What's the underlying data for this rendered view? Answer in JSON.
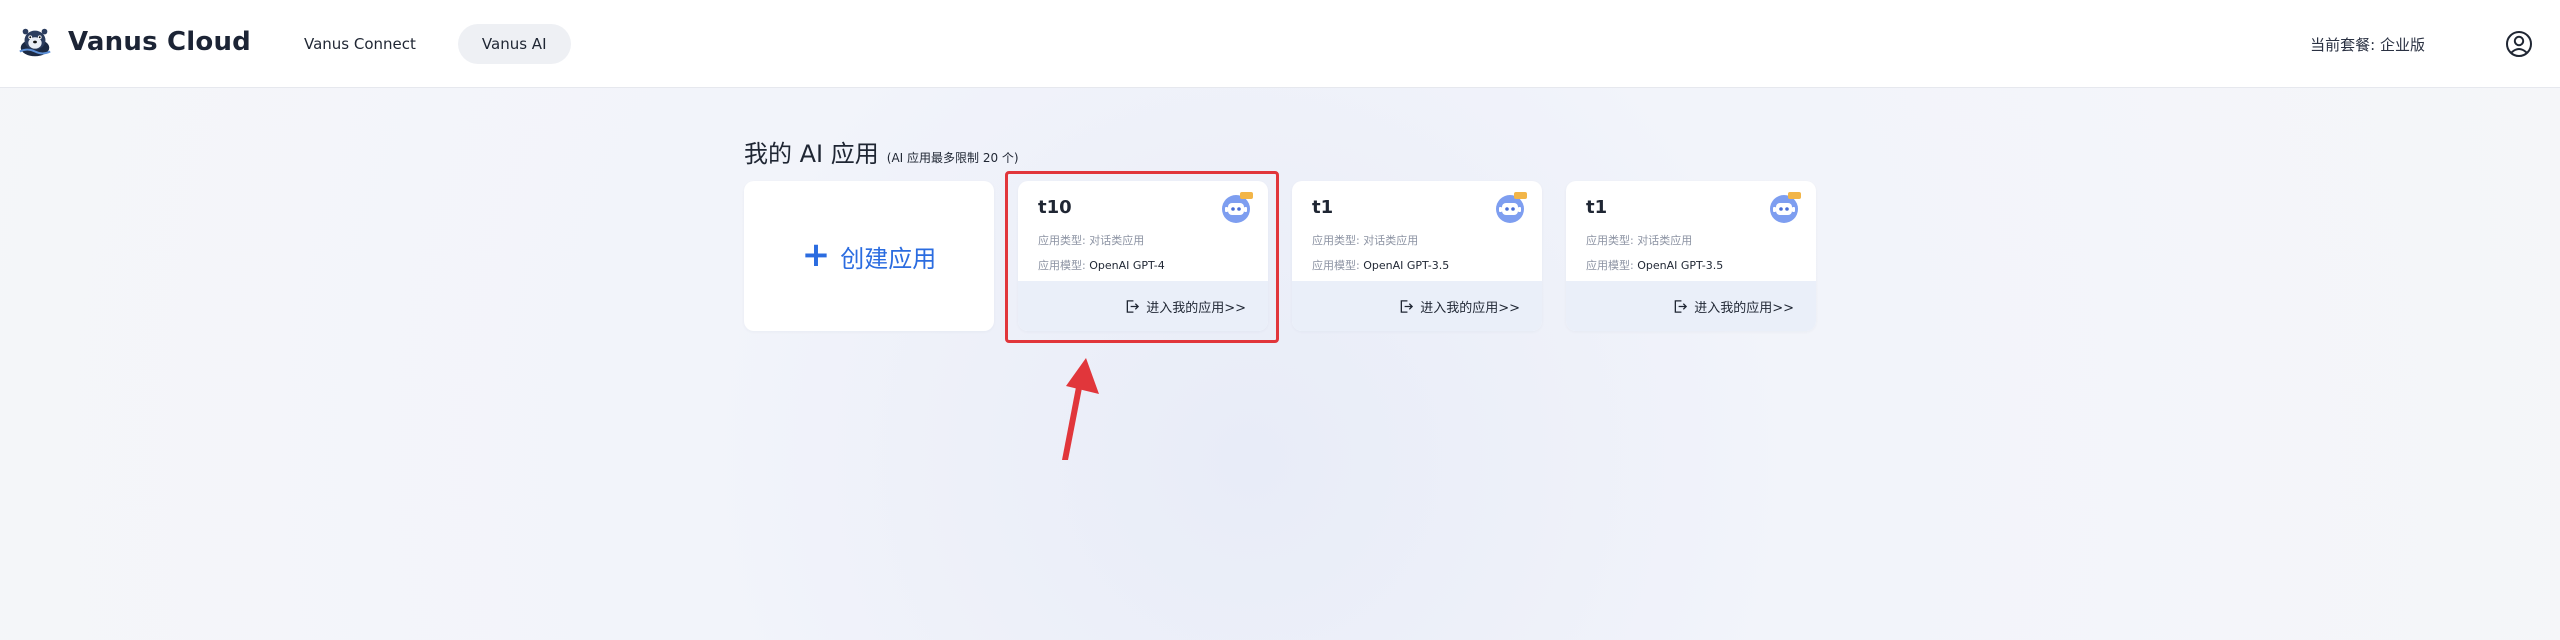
{
  "header": {
    "brand": "Vanus Cloud",
    "nav": [
      {
        "label": "Vanus Connect",
        "active": false
      },
      {
        "label": "Vanus AI",
        "active": true
      }
    ],
    "plan": "当前套餐: 企业版"
  },
  "main": {
    "title": "我的 AI 应用",
    "subtitle": "(AI 应用最多限制 20 个)",
    "create_label": "创建应用",
    "apps": [
      {
        "name": "t10",
        "type_label": "应用类型:",
        "type_value": "对话类应用",
        "model_label": "应用模型:",
        "model_value": "OpenAI GPT-4",
        "enter_label": "进入我的应用>>",
        "highlighted": true
      },
      {
        "name": "t1",
        "type_label": "应用类型:",
        "type_value": "对话类应用",
        "model_label": "应用模型:",
        "model_value": "OpenAI GPT-3.5",
        "enter_label": "进入我的应用>>",
        "highlighted": false
      },
      {
        "name": "t1",
        "type_label": "应用类型:",
        "type_value": "对话类应用",
        "model_label": "应用模型:",
        "model_value": "OpenAI GPT-3.5",
        "enter_label": "进入我的应用>>",
        "highlighted": false
      }
    ]
  },
  "icons": {
    "brand": "otter-logo-icon",
    "user": "user-circle-icon",
    "plus": "plus-icon",
    "app_avatar": "robot-avatar-icon",
    "enter": "enter-icon",
    "annotation_arrow": "arrow-icon"
  },
  "colors": {
    "accent": "#2b6ce0",
    "highlight": "#e1363b",
    "card_footer": "#eaeff9",
    "background": "#f3f5fa"
  }
}
